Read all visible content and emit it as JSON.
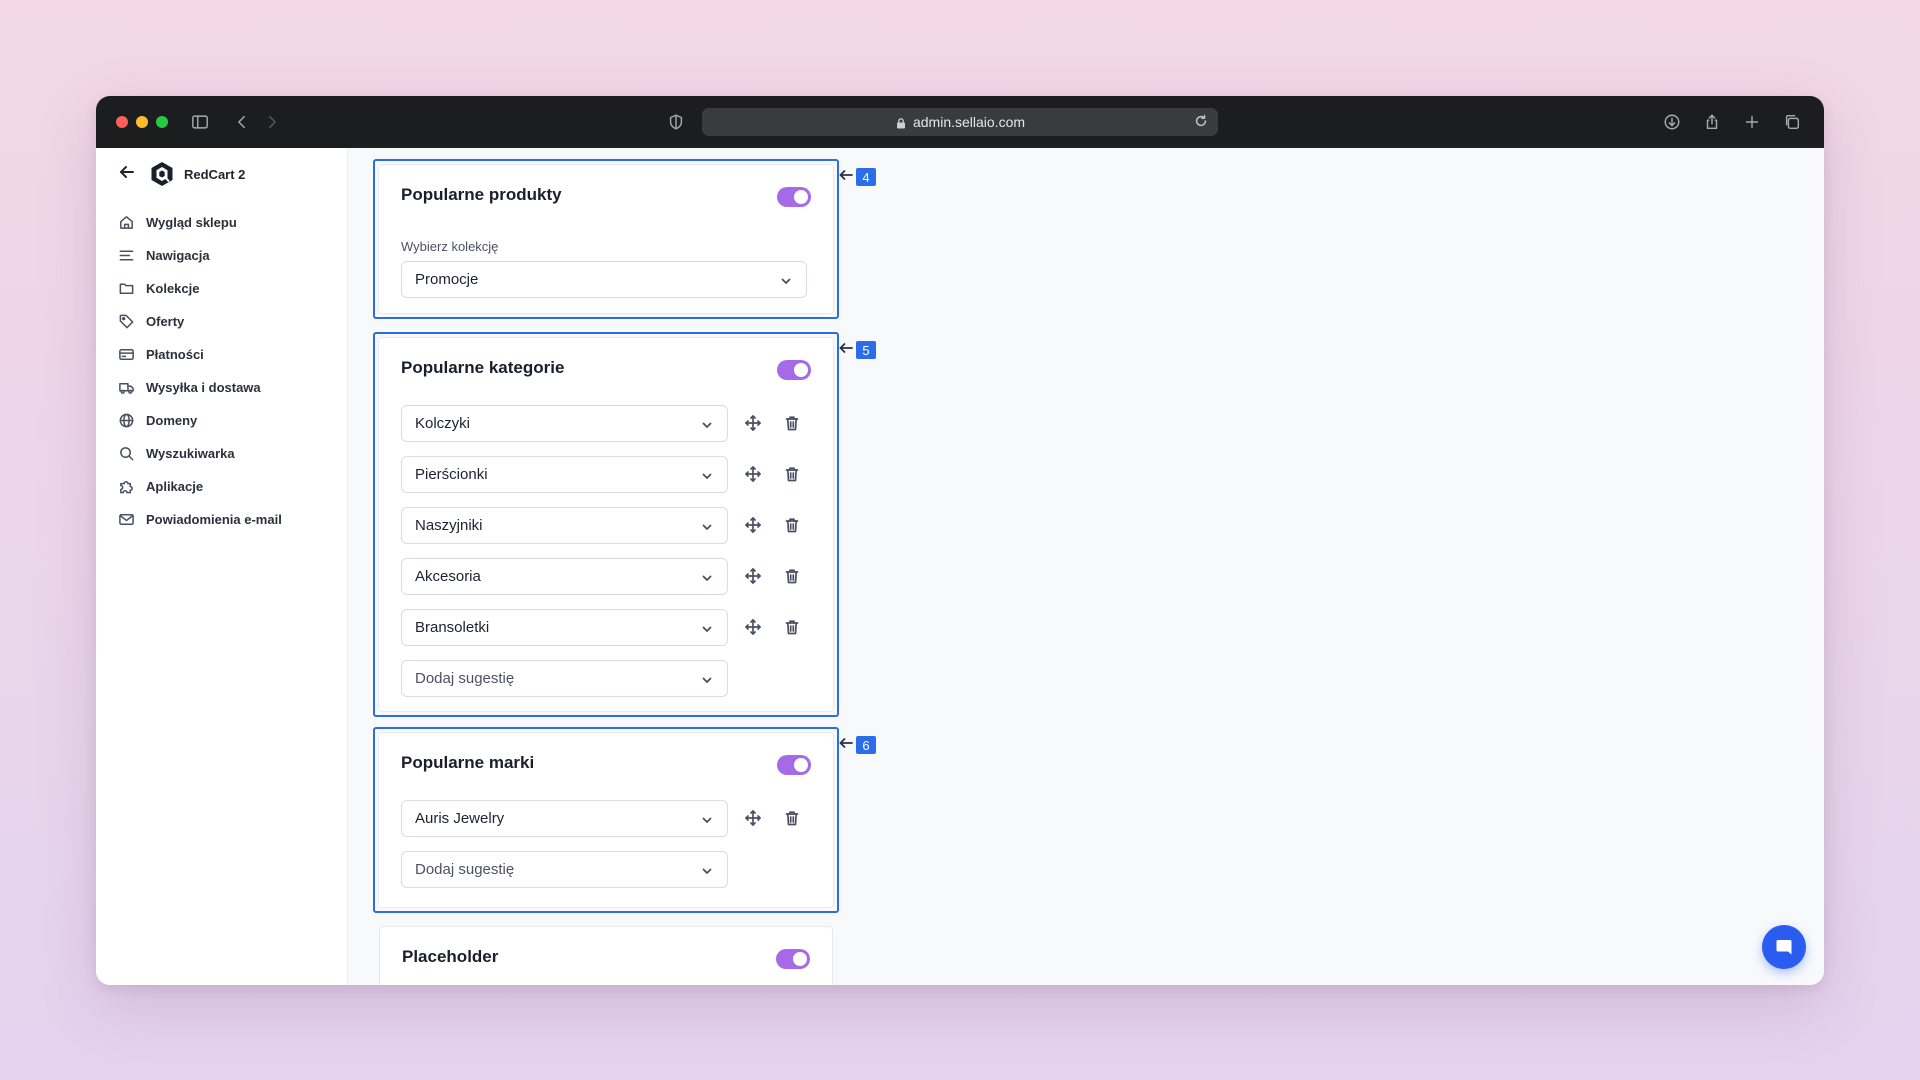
{
  "browser": {
    "url": "admin.sellaio.com"
  },
  "sidebar": {
    "brand": "RedCart 2",
    "items": [
      {
        "label": "Wygląd sklepu",
        "icon": "home-icon"
      },
      {
        "label": "Nawigacja",
        "icon": "menu-lines-icon"
      },
      {
        "label": "Kolekcje",
        "icon": "folder-icon"
      },
      {
        "label": "Oferty",
        "icon": "tag-icon"
      },
      {
        "label": "Płatności",
        "icon": "credit-card-icon"
      },
      {
        "label": "Wysyłka i dostawa",
        "icon": "truck-icon"
      },
      {
        "label": "Domeny",
        "icon": "globe-icon"
      },
      {
        "label": "Wyszukiwarka",
        "icon": "search-icon"
      },
      {
        "label": "Aplikacje",
        "icon": "puzzle-icon"
      },
      {
        "label": "Powiadomienia e-mail",
        "icon": "mail-icon"
      }
    ]
  },
  "sections": {
    "products": {
      "title": "Popularne produkty",
      "field_label": "Wybierz kolekcję",
      "selected": "Promocje",
      "marker": "4",
      "enabled": true
    },
    "categories": {
      "title": "Popularne kategorie",
      "marker": "5",
      "enabled": true,
      "items": [
        "Kolczyki",
        "Pierścionki",
        "Naszyjniki",
        "Akcesoria",
        "Bransoletki"
      ],
      "add_placeholder": "Dodaj sugestię"
    },
    "brands": {
      "title": "Popularne marki",
      "marker": "6",
      "enabled": true,
      "items": [
        "Auris Jewelry"
      ],
      "add_placeholder": "Dodaj sugestię"
    },
    "placeholder": {
      "title": "Placeholder",
      "enabled": true
    }
  },
  "colors": {
    "accent_toggle": "#a56ae8",
    "highlight_border": "#2b6de8",
    "chat_button": "#2a5cf0"
  }
}
